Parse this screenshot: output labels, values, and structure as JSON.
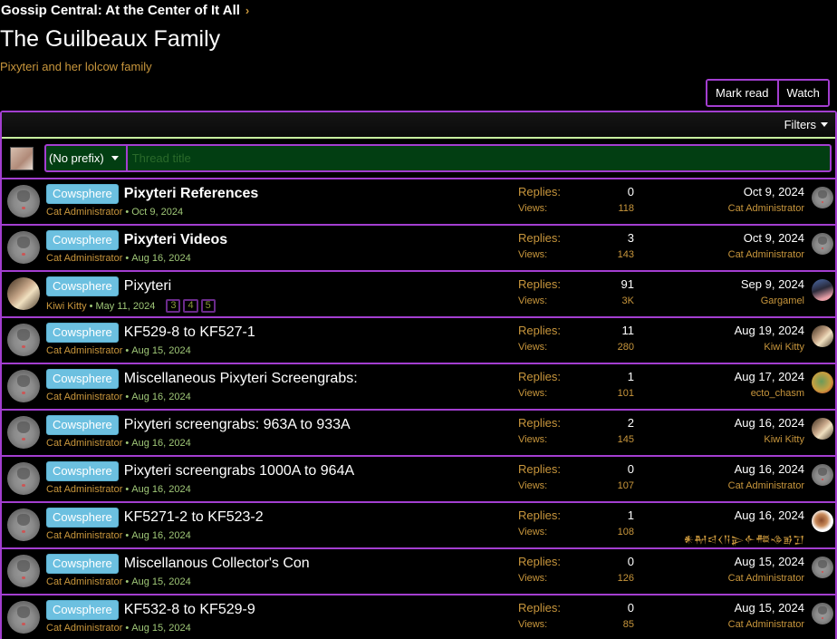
{
  "breadcrumb": {
    "label": "Gossip Central: At the Center of It All",
    "chevron": "›"
  },
  "header": {
    "title": "The Guilbeaux Family",
    "description": "Pixyteri and her lolcow family"
  },
  "actions": {
    "mark_read": "Mark read",
    "watch": "Watch"
  },
  "filters": {
    "label": "Filters"
  },
  "quick_thread": {
    "prefix": "(No prefix)",
    "placeholder": "Thread title"
  },
  "labels": {
    "replies": "Replies:",
    "views": "Views:",
    "sep": "•"
  },
  "colors": {
    "accent_border": "#a33ed0",
    "prefix_badge": "#6cc0e0",
    "username": "#c8963c",
    "date": "#a0c878",
    "input_bg": "#023e12"
  },
  "threads": [
    {
      "prefix": "Cowsphere",
      "title": "Pixyteri References",
      "bold": true,
      "author": "Cat Administrator",
      "date": "Oct 9, 2024",
      "pages": [],
      "replies": "0",
      "views": "118",
      "last_date": "Oct 9, 2024",
      "last_user": "Cat Administrator",
      "avatar": "cat",
      "last_avatar": "cat"
    },
    {
      "prefix": "Cowsphere",
      "title": "Pixyteri Videos",
      "bold": true,
      "author": "Cat Administrator",
      "date": "Aug 16, 2024",
      "pages": [],
      "replies": "3",
      "views": "143",
      "last_date": "Oct 9, 2024",
      "last_user": "Cat Administrator",
      "avatar": "cat",
      "last_avatar": "cat"
    },
    {
      "prefix": "Cowsphere",
      "title": "Pixyteri",
      "bold": false,
      "author": "Kiwi Kitty",
      "date": "May 11, 2024",
      "pages": [
        "3",
        "4",
        "5"
      ],
      "replies": "91",
      "views": "3K",
      "last_date": "Sep 9, 2024",
      "last_user": "Gargamel",
      "avatar": "kiwi",
      "last_avatar": "garg"
    },
    {
      "prefix": "Cowsphere",
      "title": "KF529-8 to KF527-1",
      "bold": false,
      "author": "Cat Administrator",
      "date": "Aug 15, 2024",
      "pages": [],
      "replies": "11",
      "views": "280",
      "last_date": "Aug 19, 2024",
      "last_user": "Kiwi Kitty",
      "avatar": "cat",
      "last_avatar": "kiwi"
    },
    {
      "prefix": "Cowsphere",
      "title": "Miscellaneous Pixyteri Screengrabs:",
      "bold": false,
      "author": "Cat Administrator",
      "date": "Aug 16, 2024",
      "pages": [],
      "replies": "1",
      "views": "101",
      "last_date": "Aug 17, 2024",
      "last_user": "ecto_chasm",
      "avatar": "cat",
      "last_avatar": "ecto"
    },
    {
      "prefix": "Cowsphere",
      "title": "Pixyteri screengrabs: 963A to 933A",
      "bold": false,
      "author": "Cat Administrator",
      "date": "Aug 16, 2024",
      "pages": [],
      "replies": "2",
      "views": "145",
      "last_date": "Aug 16, 2024",
      "last_user": "Kiwi Kitty",
      "avatar": "cat",
      "last_avatar": "kiwi"
    },
    {
      "prefix": "Cowsphere",
      "title": "Pixyteri screengrabs 1000A to 964A",
      "bold": false,
      "author": "Cat Administrator",
      "date": "Aug 16, 2024",
      "pages": [],
      "replies": "0",
      "views": "107",
      "last_date": "Aug 16, 2024",
      "last_user": "Cat Administrator",
      "avatar": "cat",
      "last_avatar": "cat"
    },
    {
      "prefix": "Cowsphere",
      "title": "KF5271-2 to KF523-2",
      "bold": false,
      "author": "Cat Administrator",
      "date": "Aug 16, 2024",
      "pages": [],
      "replies": "1",
      "views": "108",
      "last_date": "Aug 16, 2024",
      "last_user": "𒀭𒈹𒁀𒌋𒀀𒉌𒅆𒍣𒈾𒂊𒋛",
      "avatar": "cat",
      "last_avatar": "dog"
    },
    {
      "prefix": "Cowsphere",
      "title": "Miscellanous Collector's Con",
      "bold": false,
      "author": "Cat Administrator",
      "date": "Aug 15, 2024",
      "pages": [],
      "replies": "0",
      "views": "126",
      "last_date": "Aug 15, 2024",
      "last_user": "Cat Administrator",
      "avatar": "cat",
      "last_avatar": "cat"
    },
    {
      "prefix": "Cowsphere",
      "title": "KF532-8 to KF529-9",
      "bold": false,
      "author": "Cat Administrator",
      "date": "Aug 15, 2024",
      "pages": [],
      "replies": "0",
      "views": "85",
      "last_date": "Aug 15, 2024",
      "last_user": "Cat Administrator",
      "avatar": "cat",
      "last_avatar": "cat"
    }
  ]
}
